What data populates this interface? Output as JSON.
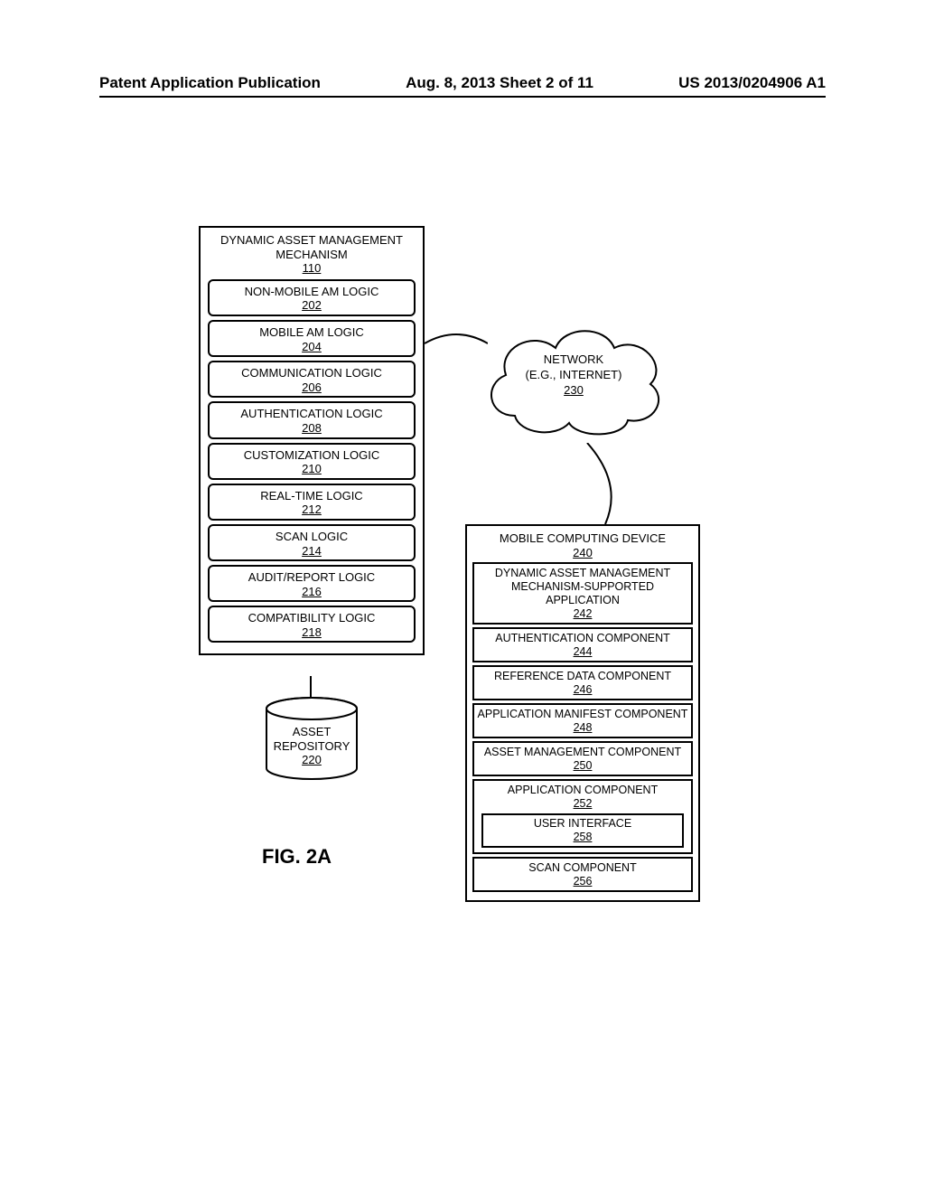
{
  "header": {
    "left": "Patent Application Publication",
    "center": "Aug. 8, 2013  Sheet 2 of 11",
    "right": "US 2013/0204906 A1"
  },
  "mechanism": {
    "title": "DYNAMIC ASSET MANAGEMENT MECHANISM",
    "ref": "110",
    "items": [
      {
        "label": "NON-MOBILE AM LOGIC",
        "ref": "202"
      },
      {
        "label": "MOBILE AM LOGIC",
        "ref": "204"
      },
      {
        "label": "COMMUNICATION LOGIC",
        "ref": "206"
      },
      {
        "label": "AUTHENTICATION LOGIC",
        "ref": "208"
      },
      {
        "label": "CUSTOMIZATION LOGIC",
        "ref": "210"
      },
      {
        "label": "REAL-TIME LOGIC",
        "ref": "212"
      },
      {
        "label": "SCAN LOGIC",
        "ref": "214"
      },
      {
        "label": "AUDIT/REPORT LOGIC",
        "ref": "216"
      },
      {
        "label": "COMPATIBILITY LOGIC",
        "ref": "218"
      }
    ]
  },
  "repository": {
    "line1": "ASSET",
    "line2": "REPOSITORY",
    "ref": "220"
  },
  "network": {
    "line1": "NETWORK",
    "line2": "(E.G., INTERNET)",
    "ref": "230"
  },
  "device": {
    "title": "MOBILE COMPUTING DEVICE",
    "ref": "240",
    "app": {
      "title": "DYNAMIC ASSET MANAGEMENT MECHANISM-SUPPORTED APPLICATION",
      "ref": "242"
    },
    "components": [
      {
        "label": "AUTHENTICATION COMPONENT",
        "ref": "244"
      },
      {
        "label": "REFERENCE DATA COMPONENT",
        "ref": "246"
      },
      {
        "label": "APPLICATION MANIFEST COMPONENT",
        "ref": "248"
      },
      {
        "label": "ASSET MANAGEMENT COMPONENT",
        "ref": "250"
      }
    ],
    "app_component": {
      "label": "APPLICATION COMPONENT",
      "ref": "252",
      "nested": {
        "label": "USER INTERFACE",
        "ref": "258"
      }
    },
    "scan": {
      "label": "SCAN COMPONENT",
      "ref": "256"
    }
  },
  "figure_label": "FIG. 2A"
}
